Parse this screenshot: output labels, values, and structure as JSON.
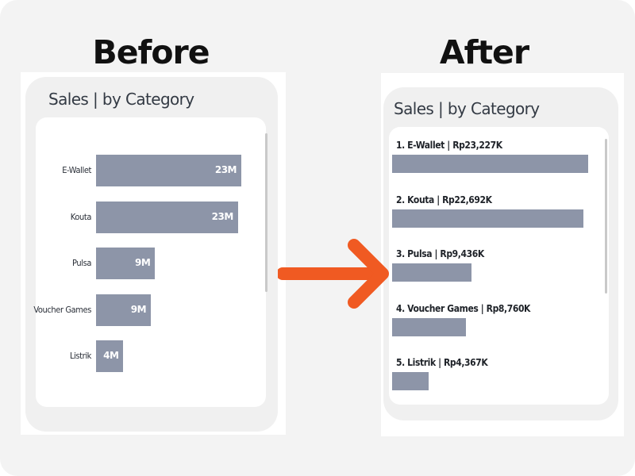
{
  "before": {
    "heading": "Before",
    "title": "Sales | by Category",
    "labels": [
      "E-Wallet",
      "Kouta",
      "Pulsa",
      "Voucher Games",
      "Listrik"
    ],
    "value_labels": [
      "23M",
      "23M",
      "9M",
      "9M",
      "4M"
    ]
  },
  "after": {
    "heading": "After",
    "title": "Sales | by Category",
    "labels": [
      "1. E-Wallet | Rp23,227K",
      "2. Kouta | Rp22,692K",
      "3. Pulsa | Rp9,436K",
      "4. Voucher Games | Rp8,760K",
      "5. Listrik | Rp4,367K"
    ]
  },
  "colors": {
    "bar": "#8d95a8",
    "arrow": "#f05a22"
  },
  "chart_data": [
    {
      "type": "bar",
      "orientation": "horizontal",
      "title": "Sales | by Category",
      "categories": [
        "E-Wallet",
        "Kouta",
        "Pulsa",
        "Voucher Games",
        "Listrik"
      ],
      "values": [
        23227,
        22692,
        9436,
        8760,
        4367
      ],
      "data_labels": [
        "23M",
        "23M",
        "9M",
        "9M",
        "4M"
      ],
      "grid": false
    },
    {
      "type": "bar",
      "orientation": "horizontal",
      "title": "Sales | by Category",
      "categories": [
        "E-Wallet",
        "Kouta",
        "Pulsa",
        "Voucher Games",
        "Listrik"
      ],
      "values": [
        23227,
        22692,
        9436,
        8760,
        4367
      ],
      "data_labels": [
        "1. E-Wallet | Rp23,227K",
        "2. Kouta | Rp22,692K",
        "3. Pulsa | Rp9,436K",
        "4. Voucher Games | Rp8,760K",
        "5. Listrik | Rp4,367K"
      ],
      "grid": false
    }
  ]
}
